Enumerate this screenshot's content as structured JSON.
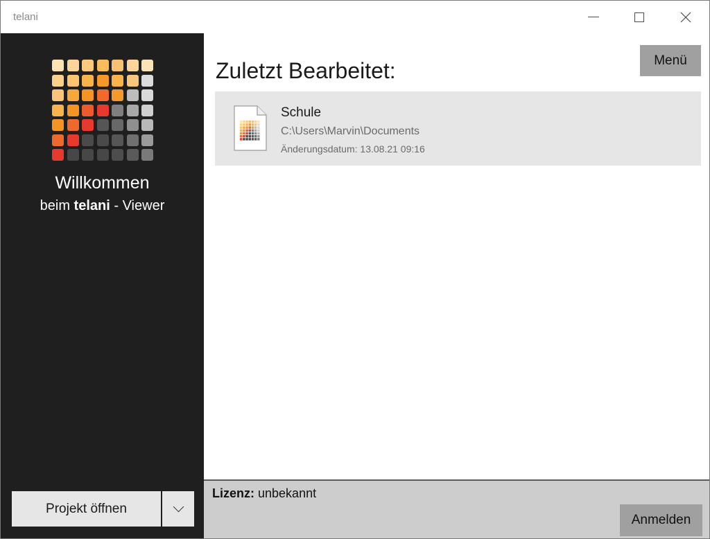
{
  "window": {
    "title": "telani"
  },
  "sidebar": {
    "welcome": "Willkommen",
    "sub_prefix": "beim",
    "sub_brand": "telani",
    "sub_suffix": "- Viewer",
    "open_button_label": "Projekt öffnen",
    "logo_colors": [
      [
        "#fde2b3",
        "#fbd59a",
        "#fbca7e",
        "#f9bc5c",
        "#f8c071",
        "#fbd59a",
        "#fbe3b8"
      ],
      [
        "#fbd08c",
        "#fbc46f",
        "#f9b34d",
        "#f6972a",
        "#f9b34d",
        "#f8c57c",
        "#dcdcdc"
      ],
      [
        "#fac47a",
        "#f7a83a",
        "#f49425",
        "#ef6a2c",
        "#f59a2a",
        "#bdbdbd",
        "#d9d9d9"
      ],
      [
        "#f9b34d",
        "#f49425",
        "#ec5b2d",
        "#e8392f",
        "#7f7f7f",
        "#a8a8a8",
        "#cfcfcf"
      ],
      [
        "#f49425",
        "#ee6a2c",
        "#e8392f",
        "#555555",
        "#686868",
        "#8f8f8f",
        "#b9b9b9"
      ],
      [
        "#ee6a2c",
        "#e8392f",
        "#4a4a4a",
        "#4a4a4a",
        "#565656",
        "#707070",
        "#9a9a9a"
      ],
      [
        "#e8392f",
        "#474747",
        "#474747",
        "#474747",
        "#4d4d4d",
        "#5a5a5a",
        "#7a7a7a"
      ]
    ]
  },
  "main": {
    "heading": "Zuletzt Bearbeitet:",
    "menu_label": "Menü",
    "recent": [
      {
        "name": "Schule",
        "path": "C:\\Users\\Marvin\\Documents",
        "date": "Änderungsdatum: 13.08.21 09:16"
      }
    ]
  },
  "footer": {
    "license_label": "Lizenz:",
    "license_value": "unbekannt",
    "login_label": "Anmelden"
  },
  "colors": {
    "sidebar_bg": "#1f1f1f",
    "button_gray": "#a0a0a0",
    "item_bg": "#e6e6e6"
  }
}
